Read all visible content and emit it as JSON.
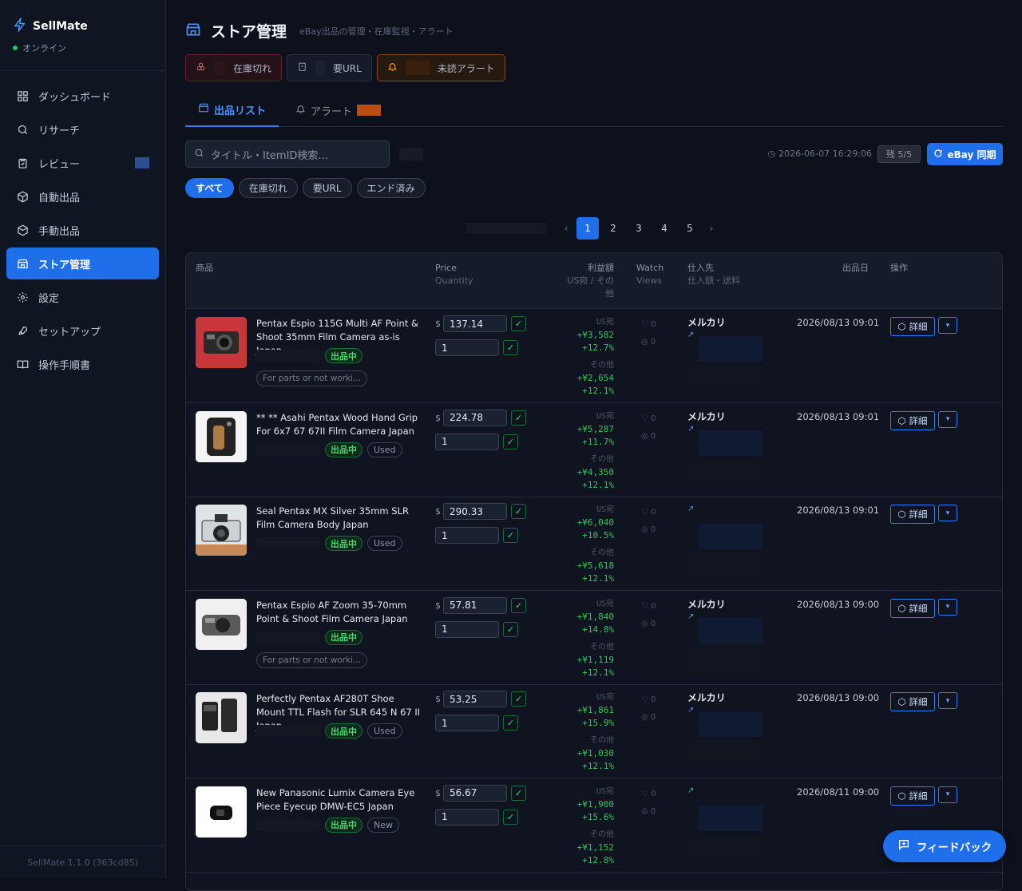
{
  "app": {
    "name": "SellMate",
    "status": "オンライン",
    "version": "SellMate 1.1.0 (363cd85)"
  },
  "sidebar": {
    "items": [
      {
        "label": "ダッシュボード",
        "icon": "grid-icon"
      },
      {
        "label": "リサーチ",
        "icon": "search-icon"
      },
      {
        "label": "レビュー",
        "icon": "clipboard-icon"
      },
      {
        "label": "自動出品",
        "icon": "box-icon"
      },
      {
        "label": "手動出品",
        "icon": "box-edit-icon"
      },
      {
        "label": "ストア管理",
        "icon": "store-icon",
        "active": true
      },
      {
        "label": "設定",
        "icon": "gear-icon"
      },
      {
        "label": "セットアップ",
        "icon": "rocket-icon"
      },
      {
        "label": "操作手順書",
        "icon": "book-icon"
      }
    ]
  },
  "header": {
    "title": "ストア管理",
    "subtitle": "eBay出品の管理・在庫監視・アラート"
  },
  "chips": {
    "out_of_stock": "在庫切れ",
    "need_url": "要URL",
    "unread_alert": "未読アラート"
  },
  "tabs": {
    "listings": "出品リスト",
    "alerts": "アラート"
  },
  "search": {
    "placeholder": "タイトル・ItemID検索..."
  },
  "sync": {
    "time": "2026-06-07 16:29:06",
    "remaining": "残 5/5",
    "button": "eBay 同期"
  },
  "filters": [
    "すべて",
    "在庫切れ",
    "要URL",
    "エンド済み"
  ],
  "pagination": {
    "pages": [
      "1",
      "2",
      "3",
      "4",
      "5"
    ],
    "current": "1",
    "prev": "‹",
    "next": "›"
  },
  "table": {
    "headers": {
      "product": "商品",
      "price": "Price",
      "quantity": "Quantity",
      "profit": "利益額",
      "profit_sub1": "US宛 / その",
      "profit_sub2": "他",
      "watch": "Watch",
      "views": "Views",
      "supplier": "仕入先",
      "supplier_sub": "仕入額・送料",
      "listed": "出品日",
      "ops": "操作"
    },
    "labels": {
      "us": "US宛",
      "other": "その他",
      "on_sale": "出品中",
      "detail": "詳細",
      "watch": "♡ 0",
      "views": "◎ 0"
    },
    "rows": [
      {
        "title": "Pentax Espio 115G Multi AF Point & Shoot 35mm Film Camera as-is Japan",
        "condition": "",
        "note": "For parts or not worki...",
        "price": "137.14",
        "qty": "1",
        "us_profit": "+¥3,582",
        "us_pct": "+12.7%",
        "other_profit": "+¥2,654",
        "other_pct": "+12.1%",
        "supplier": "メルカリ",
        "date": "2026/08/13 09:01"
      },
      {
        "title": "** ** Asahi Pentax Wood Hand Grip For 6x7 67 67II Film Camera Japan",
        "condition": "Used",
        "note": "",
        "price": "224.78",
        "qty": "1",
        "us_profit": "+¥5,287",
        "us_pct": "+11.7%",
        "other_profit": "+¥4,350",
        "other_pct": "+12.1%",
        "supplier": "メルカリ",
        "date": "2026/08/13 09:01"
      },
      {
        "title": "Seal Pentax MX Silver 35mm SLR Film Camera Body Japan",
        "condition": "Used",
        "note": "",
        "price": "290.33",
        "qty": "1",
        "us_profit": "+¥6,040",
        "us_pct": "+10.5%",
        "other_profit": "+¥5,618",
        "other_pct": "+12.1%",
        "supplier": "",
        "date": "2026/08/13 09:01"
      },
      {
        "title": "Pentax Espio AF Zoom 35-70mm Point & Shoot Film Camera Japan",
        "condition": "",
        "note": "For parts or not worki...",
        "price": "57.81",
        "qty": "1",
        "us_profit": "+¥1,840",
        "us_pct": "+14.8%",
        "other_profit": "+¥1,119",
        "other_pct": "+12.1%",
        "supplier": "メルカリ",
        "date": "2026/08/13 09:00"
      },
      {
        "title": "Perfectly Pentax AF280T Shoe Mount TTL Flash for SLR 645 N 67 II Japan",
        "condition": "Used",
        "note": "",
        "price": "53.25",
        "qty": "1",
        "us_profit": "+¥1,861",
        "us_pct": "+15.9%",
        "other_profit": "+¥1,030",
        "other_pct": "+12.1%",
        "supplier": "メルカリ",
        "date": "2026/08/13 09:00"
      },
      {
        "title": "New Panasonic Lumix Camera Eye Piece Eyecup DMW-EC5 Japan",
        "condition": "New",
        "note": "",
        "price": "56.67",
        "qty": "1",
        "us_profit": "+¥1,900",
        "us_pct": "+15.6%",
        "other_profit": "+¥1,152",
        "other_pct": "+12.8%",
        "supplier": "",
        "date": "2026/08/11 09:00"
      }
    ]
  },
  "feedback": {
    "label": "フィードバック"
  },
  "colors": {
    "accent": "#1f6feb",
    "bg": "#0d111c",
    "profit": "#35c45f",
    "alert": "#b94d14"
  }
}
